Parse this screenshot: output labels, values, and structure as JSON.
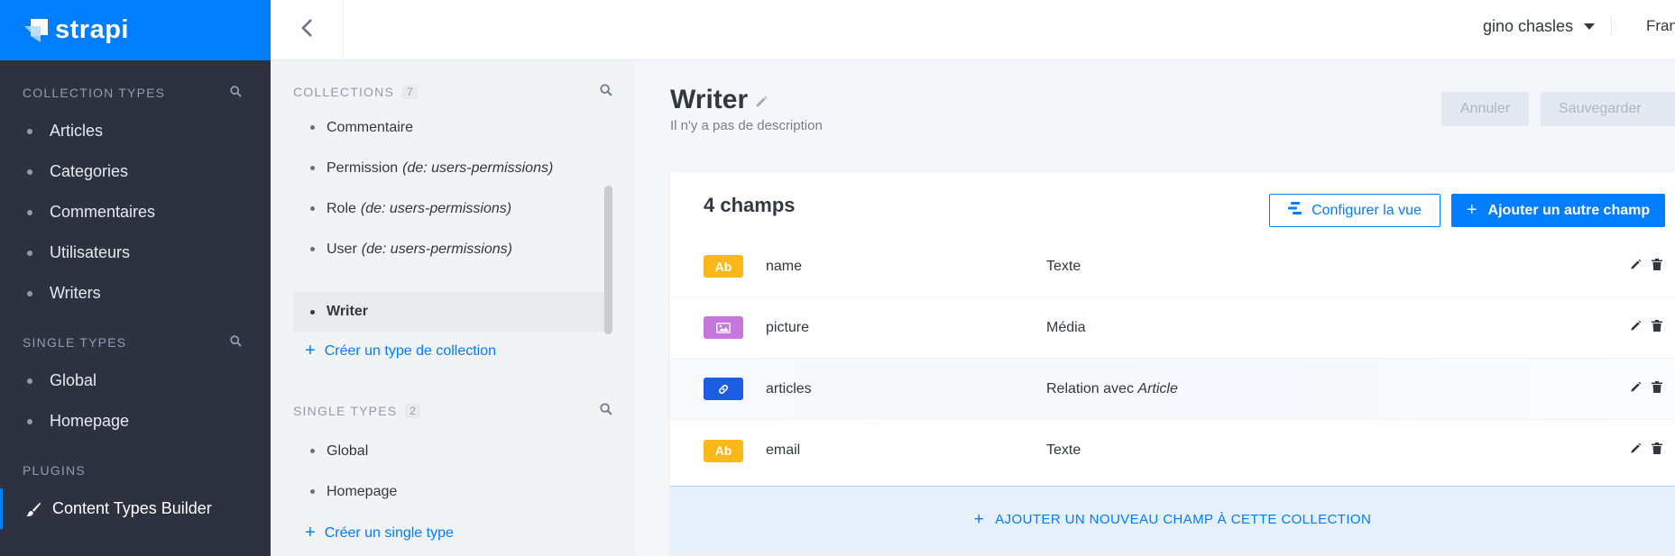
{
  "brand": {
    "name": "strapi",
    "color": "#007eff"
  },
  "leftnav": {
    "collection_types": {
      "heading": "COLLECTION TYPES",
      "items": [
        "Articles",
        "Categories",
        "Commentaires",
        "Utilisateurs",
        "Writers"
      ]
    },
    "single_types": {
      "heading": "SINGLE TYPES",
      "items": [
        "Global",
        "Homepage"
      ]
    },
    "plugins": {
      "heading": "PLUGINS",
      "items": [
        "Content Types Builder"
      ]
    }
  },
  "header": {
    "user": "gino chasles",
    "language": "Français"
  },
  "ctmenu": {
    "collections": {
      "heading": "COLLECTIONS",
      "count": "7",
      "items": [
        {
          "label": "Commentaire",
          "suffix": ""
        },
        {
          "label": "Permission",
          "suffix": "(de: users-permissions)"
        },
        {
          "label": "Role",
          "suffix": "(de: users-permissions)"
        },
        {
          "label": "User",
          "suffix": "(de: users-permissions)"
        },
        {
          "label": "Writer",
          "suffix": ""
        }
      ],
      "add_label": "Créer un type de collection"
    },
    "single_types": {
      "heading": "SINGLE TYPES",
      "count": "2",
      "items": [
        {
          "label": "Global"
        },
        {
          "label": "Homepage"
        }
      ],
      "add_label": "Créer un single type"
    }
  },
  "main": {
    "title": "Writer",
    "subtitle": "Il n'y a pas de description",
    "cancel_label": "Annuler",
    "save_label": "Sauvegarder",
    "fields_count_label": "4 champs",
    "configure_label": "Configurer la vue",
    "add_field_label": "Ajouter un autre champ",
    "fields": [
      {
        "icon": "Ab",
        "name": "name",
        "type": "Texte",
        "type_ref": "",
        "color": "#fab81b"
      },
      {
        "icon": "media",
        "name": "picture",
        "type": "Média",
        "type_ref": "",
        "color": "#c776de"
      },
      {
        "icon": "link",
        "name": "articles",
        "type": "Relation avec",
        "type_ref": "Article",
        "color": "#1b5de3"
      },
      {
        "icon": "Ab",
        "name": "email",
        "type": "Texte",
        "type_ref": "",
        "color": "#fab81b"
      }
    ],
    "add_new_label": "AJOUTER UN NOUVEAU CHAMP À CETTE COLLECTION"
  }
}
